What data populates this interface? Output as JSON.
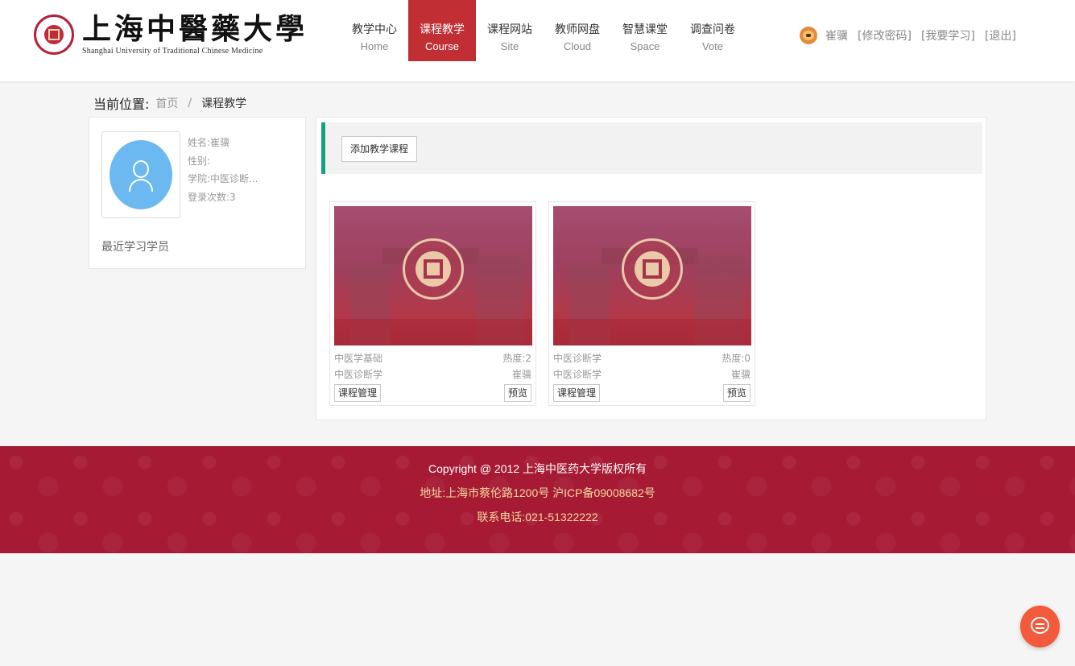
{
  "header": {
    "logo_cn": "上海中醫藥大學",
    "logo_en": "Shanghai University of Traditional Chinese Medicine",
    "nav": [
      {
        "cn": "教学中心",
        "en": "Home"
      },
      {
        "cn": "课程教学",
        "en": "Course",
        "active": true
      },
      {
        "cn": "课程网站",
        "en": "Site"
      },
      {
        "cn": "教师网盘",
        "en": "Cloud"
      },
      {
        "cn": "智慧课堂",
        "en": "Space"
      },
      {
        "cn": "调查问卷",
        "en": "Vote"
      }
    ],
    "user": {
      "name": "崔骥",
      "change_password": "[修改密码]",
      "my_learning": "[我要学习]",
      "logout": "[退出]"
    }
  },
  "breadcrumb": {
    "label": "当前位置:",
    "home": "首页",
    "separator": "/",
    "current": "课程教学"
  },
  "profile": {
    "name": "姓名:崔骥",
    "gender": "性别:",
    "college": "学院:中医诊断...",
    "login_count": "登录次数:3",
    "recent_title": "最近学习学员"
  },
  "toolbar": {
    "add_course": "添加教学课程"
  },
  "courses": [
    {
      "name": "中医学基础",
      "heat": "热度:2",
      "dept": "中医诊断学",
      "teacher": "崔骥",
      "manage": "课程管理",
      "preview": "预览"
    },
    {
      "name": "中医诊断学",
      "heat": "热度:0",
      "dept": "中医诊断学",
      "teacher": "崔骥",
      "manage": "课程管理",
      "preview": "预览"
    }
  ],
  "footer": {
    "copyright": "Copyright @ 2012 上海中医药大学版权所有",
    "address": "地址:上海市蔡伦路1200号 沪ICP备09008682号",
    "phone": "联系电话:021-51322222"
  },
  "colors": {
    "brand_red": "#c12f35",
    "footer_red": "#a61a34",
    "accent_green": "#16a085",
    "chat_orange": "#f25a3b"
  }
}
